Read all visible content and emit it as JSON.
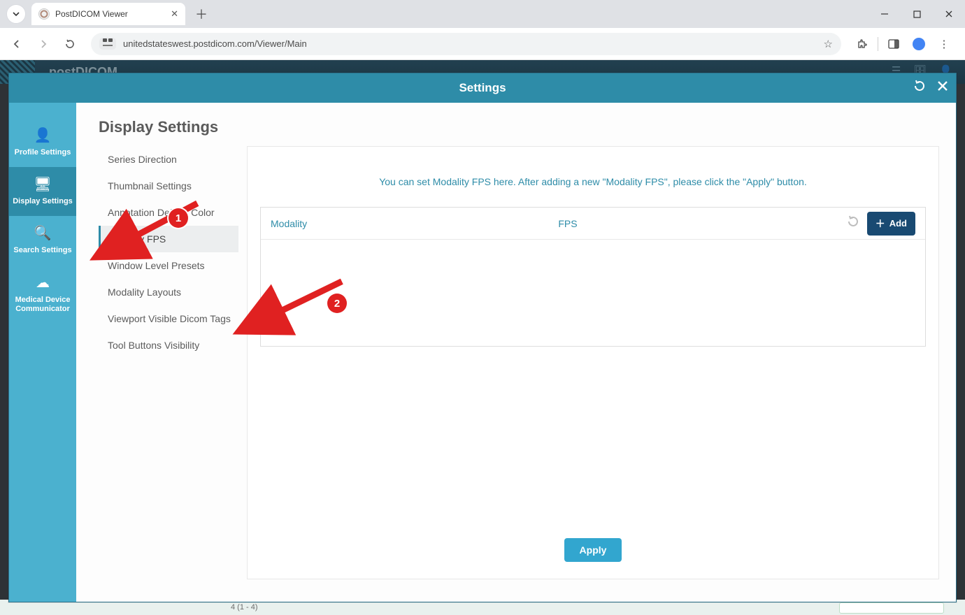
{
  "browser": {
    "tab_title": "PostDICOM Viewer",
    "url": "unitedstateswest.postdicom.com/Viewer/Main",
    "site_chip": "⧈"
  },
  "background": {
    "logo_text": "postDICOM"
  },
  "modal": {
    "title": "Settings",
    "page_title": "Display Settings",
    "left_tabs": [
      {
        "icon": "👤",
        "label": "Profile Settings",
        "active": false,
        "key": "profile-settings"
      },
      {
        "icon": "🖥",
        "label": "Display Settings",
        "active": true,
        "key": "display-settings"
      },
      {
        "icon": "🔍",
        "label": "Search Settings",
        "active": false,
        "key": "search-settings"
      },
      {
        "icon": "☁",
        "label": "Medical Device Communicator",
        "active": false,
        "key": "medical-device-communicator"
      }
    ],
    "submenu": [
      {
        "label": "Series Direction",
        "active": false,
        "key": "series-direction"
      },
      {
        "label": "Thumbnail Settings",
        "active": false,
        "key": "thumbnail-settings"
      },
      {
        "label": "Annotation Default Color",
        "active": false,
        "key": "annotation-default-color"
      },
      {
        "label": "Modality FPS",
        "active": true,
        "key": "modality-fps"
      },
      {
        "label": "Window Level Presets",
        "active": false,
        "key": "window-level-presets"
      },
      {
        "label": "Modality Layouts",
        "active": false,
        "key": "modality-layouts"
      },
      {
        "label": "Viewport Visible Dicom Tags",
        "active": false,
        "key": "viewport-visible-dicom-tags"
      },
      {
        "label": "Tool Buttons Visibility",
        "active": false,
        "key": "tool-buttons-visibility"
      }
    ],
    "help_text": "You can set Modality FPS here. After adding a new \"Modality FPS\", please click the \"Apply\" button.",
    "grid": {
      "col_modality": "Modality",
      "col_fps": "FPS",
      "add_label": "Add",
      "rows": []
    },
    "apply_label": "Apply"
  },
  "annotations": {
    "badge1": "1",
    "badge2": "2"
  },
  "footer_text": "4 (1 - 4)"
}
